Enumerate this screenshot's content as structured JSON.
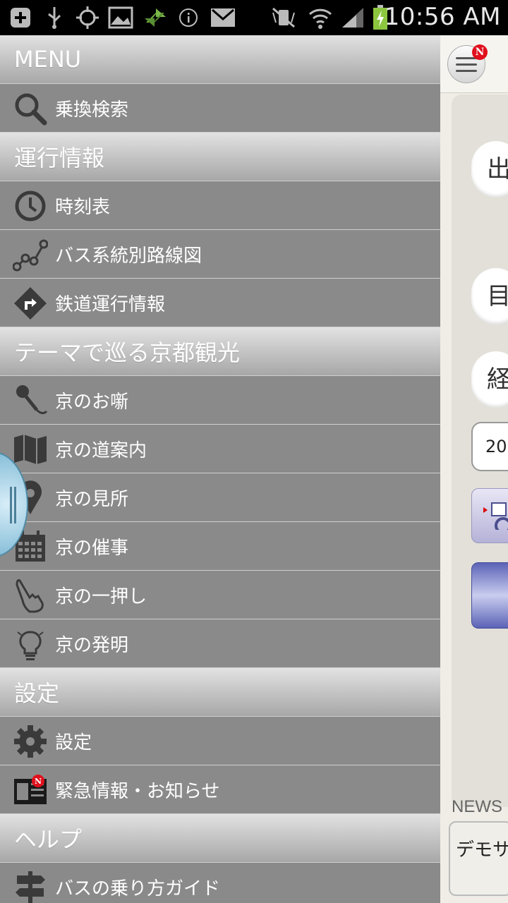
{
  "status_bar": {
    "time": "10:56 AM"
  },
  "drawer": {
    "menu_title": "MENU",
    "sections": {
      "search": {
        "label": "乗換検索"
      },
      "operation_header": {
        "label": "運行情報"
      },
      "timetable": {
        "label": "時刻表"
      },
      "bus_route_map": {
        "label": "バス系統別路線図"
      },
      "railway_info": {
        "label": "鉄道運行情報"
      },
      "theme_header": {
        "label": "テーマで巡る京都観光"
      },
      "kyo_ohanashi": {
        "label": "京のお噺"
      },
      "kyo_michi": {
        "label": "京の道案内"
      },
      "kyo_midokoro": {
        "label": "京の見所"
      },
      "kyo_moyooshi": {
        "label": "京の催事"
      },
      "kyo_hitooshi": {
        "label": "京の一押し"
      },
      "kyo_hatsumei": {
        "label": "京の発明"
      },
      "settings_header": {
        "label": "設定"
      },
      "settings": {
        "label": "設定"
      },
      "emergency": {
        "label": "緊急情報・お知らせ"
      },
      "help_header": {
        "label": "ヘルプ"
      },
      "bus_guide": {
        "label": "バスの乗り方ガイド"
      }
    }
  },
  "content": {
    "badge": "N",
    "departure_label": "出",
    "destination_label": "目",
    "via_label": "経",
    "date_value": "20",
    "news_label": "NEWS",
    "news_text": "デモサ"
  }
}
